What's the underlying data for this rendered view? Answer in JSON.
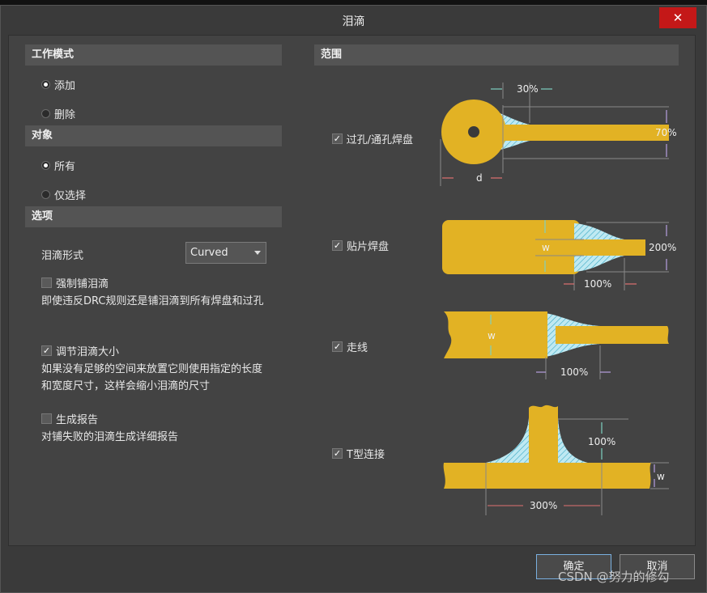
{
  "dialog": {
    "title": "泪滴",
    "close_glyph": "✕"
  },
  "work_mode": {
    "heading": "工作模式",
    "options": [
      "添加",
      "删除"
    ],
    "selected": "添加"
  },
  "target": {
    "heading": "对象",
    "options": [
      "所有",
      "仅选择"
    ],
    "selected": "所有"
  },
  "options": {
    "heading": "选项",
    "style_label": "泪滴形式",
    "style_value": "Curved",
    "force": {
      "label": "强制铺泪滴",
      "checked": false,
      "description": "即使违反DRC规则还是铺泪滴到所有焊盘和过孔"
    },
    "adjust": {
      "label": "调节泪滴大小",
      "checked": true,
      "description": "如果没有足够的空间来放置它则使用指定的长度和宽度尺寸，这样会缩小泪滴的尺寸"
    },
    "report": {
      "label": "生成报告",
      "checked": false,
      "description": "对铺失败的泪滴生成详细报告"
    }
  },
  "scope": {
    "heading": "范围",
    "items": [
      {
        "label": "过孔/通孔焊盘",
        "checked": true
      },
      {
        "label": "贴片焊盘",
        "checked": true
      },
      {
        "label": "走线",
        "checked": true
      },
      {
        "label": "T型连接",
        "checked": true
      }
    ],
    "diagram_labels": {
      "via_top": "30%",
      "via_right": "70%",
      "via_bottom": "d",
      "smd_w": "w",
      "smd_right": "200%",
      "smd_bottom": "100%",
      "track_w": "w",
      "track_bottom": "100%",
      "t_right": "100%",
      "t_w": "w",
      "t_bottom": "300%"
    }
  },
  "buttons": {
    "ok": "确定",
    "cancel": "取消"
  },
  "watermark": "CSDN @努力的修勾",
  "colors": {
    "copper": "#e2b224",
    "teardrop_fill": "#bfe9f2",
    "hatch": "#3aa9c4"
  }
}
